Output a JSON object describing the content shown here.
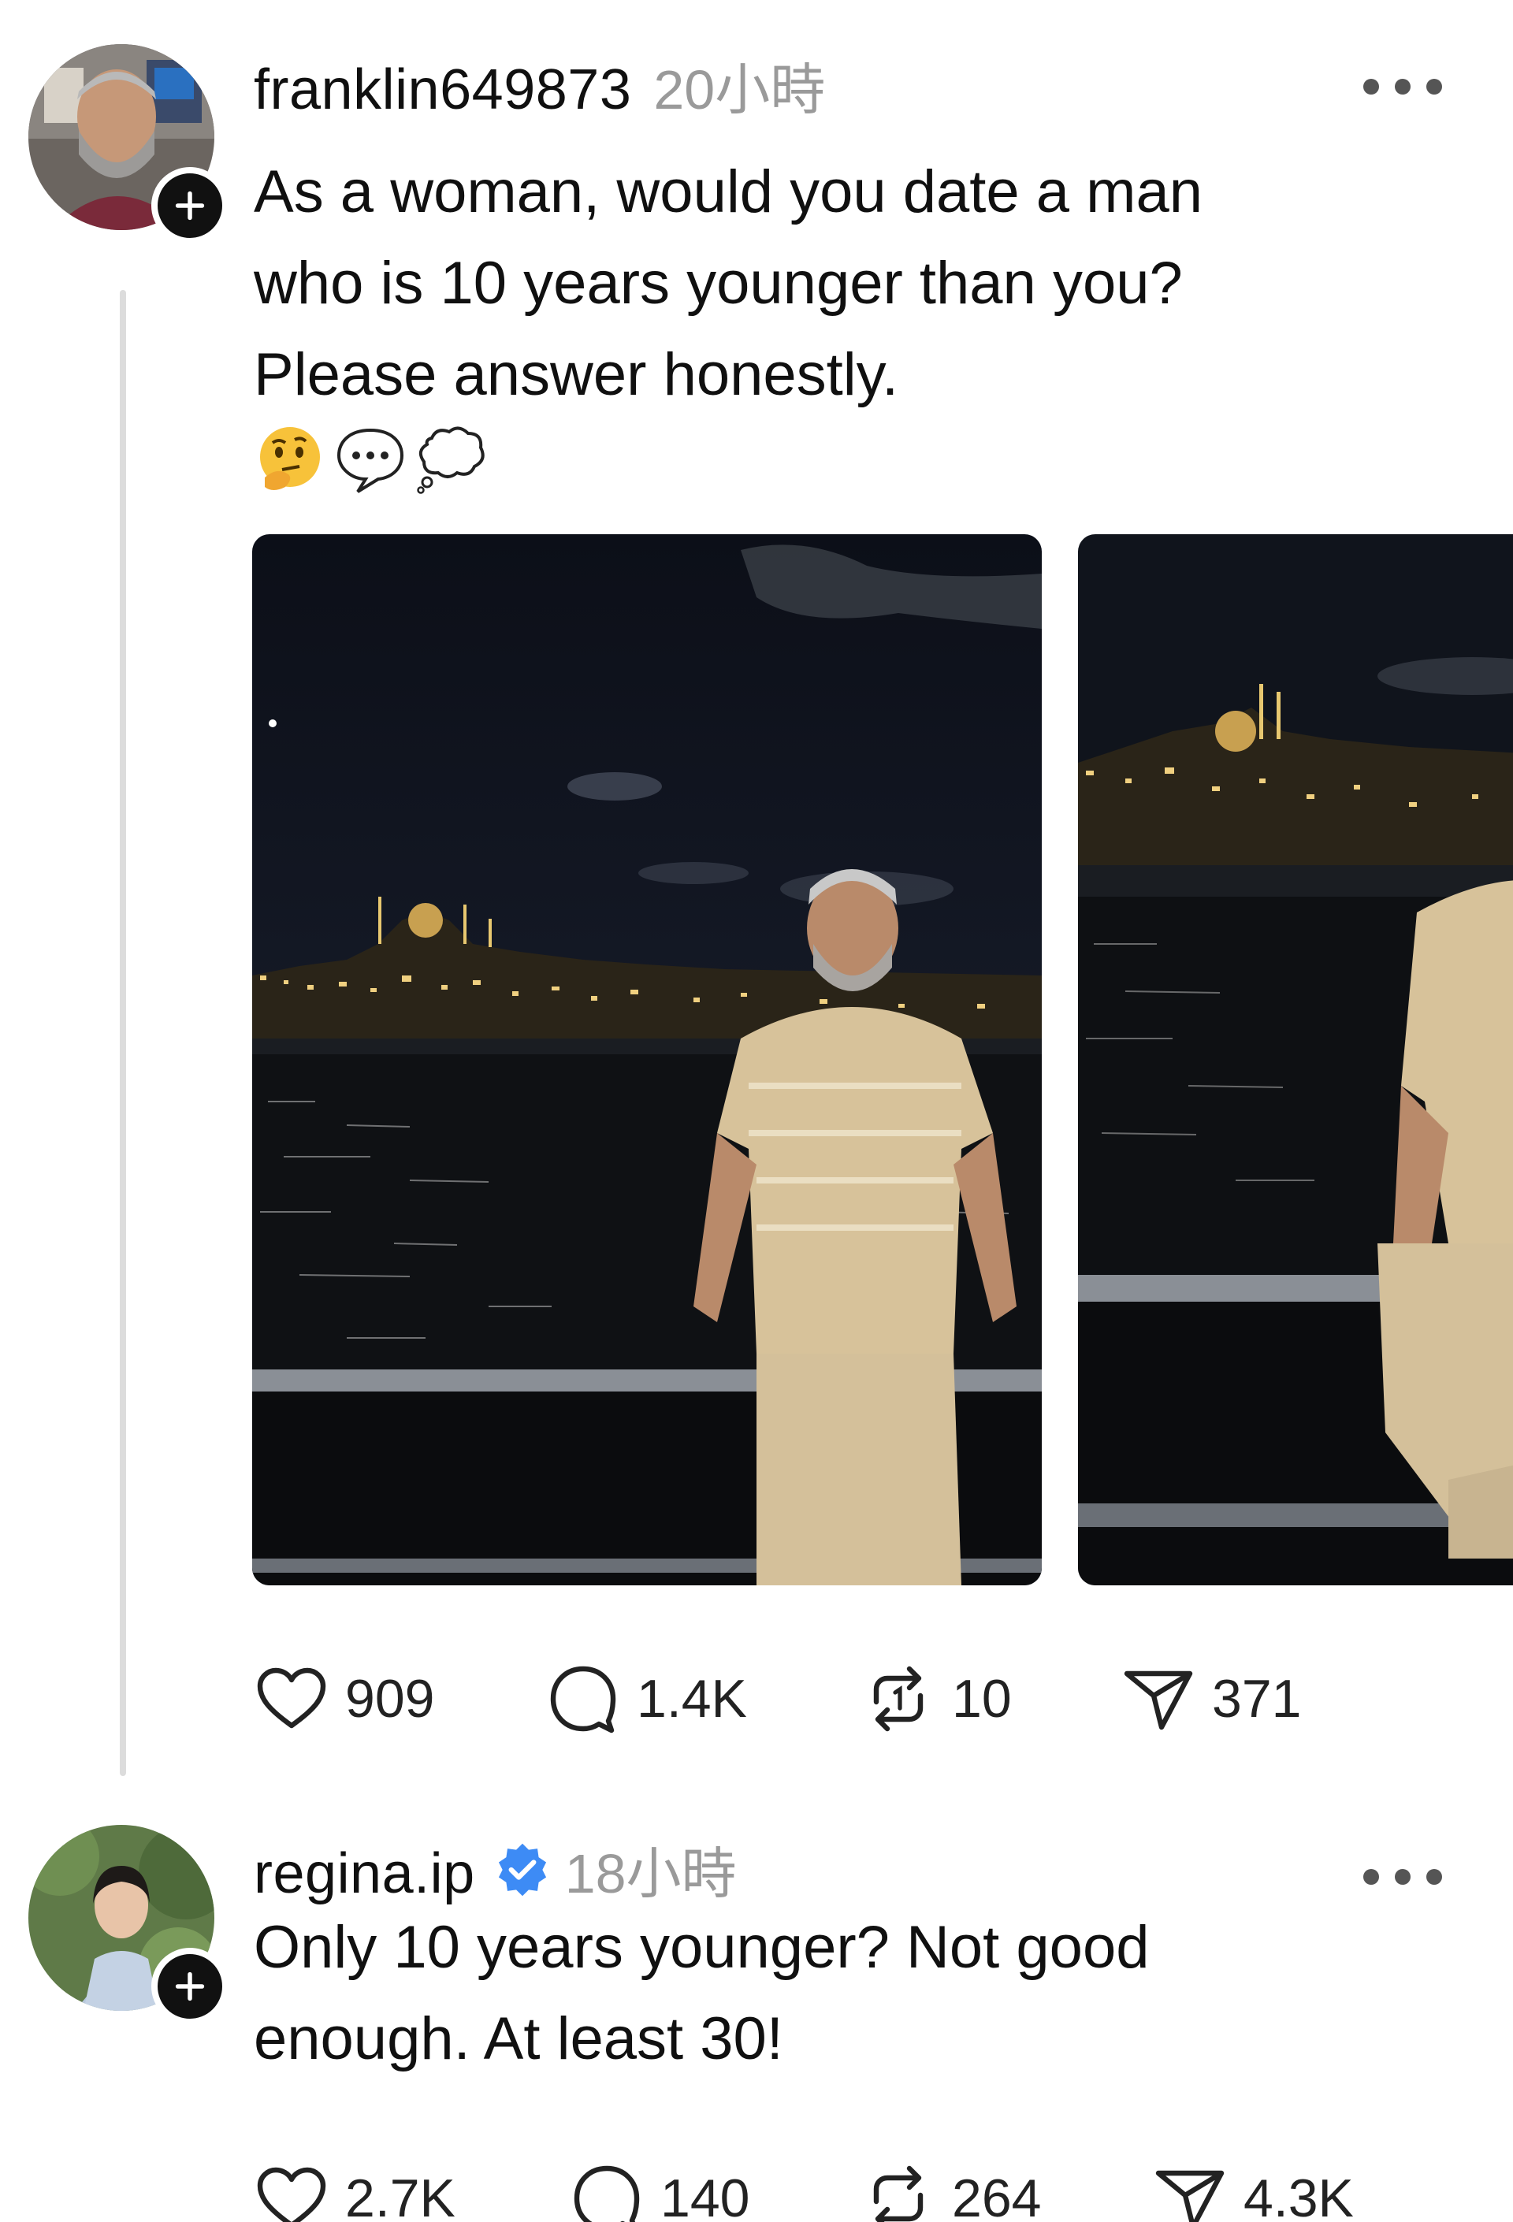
{
  "posts": [
    {
      "username": "franklin649873",
      "time": "20小時",
      "text": "As a woman, would you date a man\nwho is 10 years younger than you?\nPlease answer honestly.",
      "emojis": [
        "thinking-face",
        "speech-balloon",
        "thought-balloon"
      ],
      "images": 2,
      "likes": "909",
      "comments": "1.4K",
      "reposts": "10",
      "shares": "371"
    },
    {
      "username": "regina.ip",
      "verified": true,
      "time": "18小時",
      "text": "Only 10 years younger? Not good\nenough. At least 30!",
      "likes": "2.7K",
      "comments": "140",
      "reposts": "264",
      "shares": "4.3K"
    }
  ],
  "colors": {
    "text": "#101010",
    "muted": "#9a9a9a",
    "verified_blue": "#3d8bf5",
    "thread_line": "#dcdcdc"
  }
}
